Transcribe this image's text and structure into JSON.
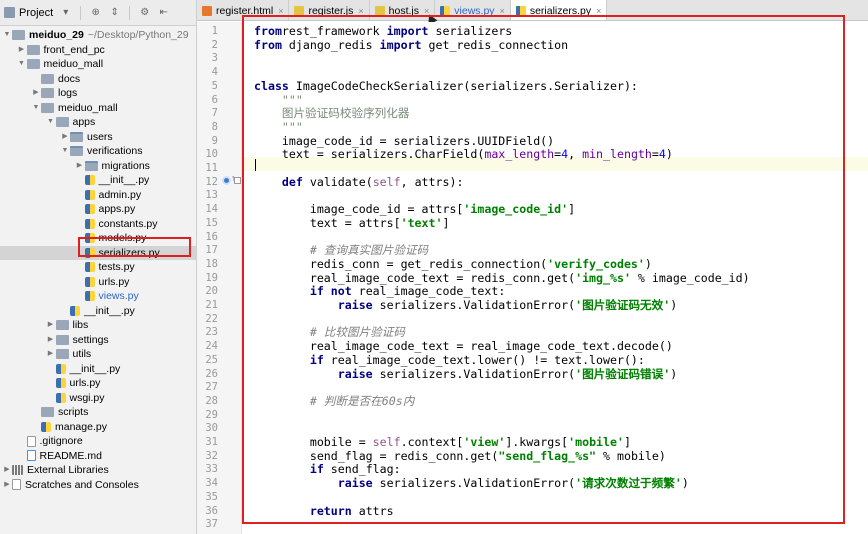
{
  "project_panel": {
    "title": "Project",
    "toolbar_icons": [
      "project-folder-icon",
      "target-icon",
      "collapse-icon",
      "gear-icon",
      "hide-icon"
    ],
    "tree": [
      {
        "depth": 0,
        "arrow": "down",
        "icon": "folder",
        "label": "meiduo_29",
        "extra": "~/Desktop/Python_29",
        "bold": true
      },
      {
        "depth": 1,
        "arrow": "right",
        "icon": "folder",
        "label": "front_end_pc"
      },
      {
        "depth": 1,
        "arrow": "down",
        "icon": "folder",
        "label": "meiduo_mall"
      },
      {
        "depth": 2,
        "arrow": "",
        "icon": "folder",
        "label": "docs"
      },
      {
        "depth": 2,
        "arrow": "right",
        "icon": "folder",
        "label": "logs"
      },
      {
        "depth": 2,
        "arrow": "down",
        "icon": "folder",
        "label": "meiduo_mall"
      },
      {
        "depth": 3,
        "arrow": "down",
        "icon": "folder",
        "label": "apps"
      },
      {
        "depth": 4,
        "arrow": "right",
        "icon": "pkg",
        "label": "users"
      },
      {
        "depth": 4,
        "arrow": "down",
        "icon": "pkg",
        "label": "verifications"
      },
      {
        "depth": 5,
        "arrow": "right",
        "icon": "pkg",
        "label": "migrations"
      },
      {
        "depth": 5,
        "arrow": "",
        "icon": "py",
        "label": "__init__.py"
      },
      {
        "depth": 5,
        "arrow": "",
        "icon": "py",
        "label": "admin.py"
      },
      {
        "depth": 5,
        "arrow": "",
        "icon": "py",
        "label": "apps.py"
      },
      {
        "depth": 5,
        "arrow": "",
        "icon": "py",
        "label": "constants.py"
      },
      {
        "depth": 5,
        "arrow": "",
        "icon": "py",
        "label": "models.py"
      },
      {
        "depth": 5,
        "arrow": "",
        "icon": "py",
        "label": "serializers.py",
        "selected": true
      },
      {
        "depth": 5,
        "arrow": "",
        "icon": "py",
        "label": "tests.py"
      },
      {
        "depth": 5,
        "arrow": "",
        "icon": "py",
        "label": "urls.py"
      },
      {
        "depth": 5,
        "arrow": "",
        "icon": "py",
        "label": "views.py",
        "modified": true
      },
      {
        "depth": 4,
        "arrow": "",
        "icon": "py",
        "label": "__init__.py"
      },
      {
        "depth": 3,
        "arrow": "right",
        "icon": "folder",
        "label": "libs"
      },
      {
        "depth": 3,
        "arrow": "right",
        "icon": "folder",
        "label": "settings"
      },
      {
        "depth": 3,
        "arrow": "right",
        "icon": "folder",
        "label": "utils"
      },
      {
        "depth": 3,
        "arrow": "",
        "icon": "py",
        "label": "__init__.py"
      },
      {
        "depth": 3,
        "arrow": "",
        "icon": "py",
        "label": "urls.py"
      },
      {
        "depth": 3,
        "arrow": "",
        "icon": "py",
        "label": "wsgi.py"
      },
      {
        "depth": 2,
        "arrow": "",
        "icon": "folder",
        "label": "scripts"
      },
      {
        "depth": 2,
        "arrow": "",
        "icon": "py",
        "label": "manage.py"
      },
      {
        "depth": 1,
        "arrow": "",
        "icon": "txt",
        "label": ".gitignore"
      },
      {
        "depth": 1,
        "arrow": "",
        "icon": "md",
        "label": "README.md"
      },
      {
        "depth": 0,
        "arrow": "right",
        "icon": "lib",
        "label": "External Libraries"
      },
      {
        "depth": 0,
        "arrow": "right",
        "icon": "txt",
        "label": "Scratches and Consoles"
      }
    ]
  },
  "tabs": [
    {
      "label": "register.html",
      "icon": "html",
      "active": false,
      "modified": false
    },
    {
      "label": "register.js",
      "icon": "js",
      "active": false,
      "modified": false
    },
    {
      "label": "host.js",
      "icon": "js",
      "active": false,
      "modified": false
    },
    {
      "label": "views.py",
      "icon": "py",
      "active": false,
      "modified": true
    },
    {
      "label": "serializers.py",
      "icon": "py",
      "active": true,
      "modified": false
    }
  ],
  "tab_close_glyph": "×",
  "editor": {
    "lines": [
      {
        "n": "1",
        "t": [
          [
            "kw",
            "from"
          ],
          [
            "",
            "rest_framework "
          ],
          [
            "kw",
            "import"
          ],
          [
            "",
            " serializers"
          ]
        ]
      },
      {
        "n": "2",
        "t": [
          [
            "kw",
            "from"
          ],
          [
            "",
            " django_redis "
          ],
          [
            "kw",
            "import"
          ],
          [
            "",
            " get_redis_connection"
          ]
        ]
      },
      {
        "n": "3",
        "t": []
      },
      {
        "n": "4",
        "t": []
      },
      {
        "n": "5",
        "t": [
          [
            "kw",
            "class"
          ],
          [
            "",
            " ImageCodeCheckSerializer(serializers.Serializer):"
          ]
        ]
      },
      {
        "n": "6",
        "t": [
          [
            "doc",
            "    \"\"\""
          ]
        ]
      },
      {
        "n": "7",
        "t": [
          [
            "doc",
            "    图片验证码校验序列化器"
          ]
        ]
      },
      {
        "n": "8",
        "t": [
          [
            "doc",
            "    \"\"\""
          ]
        ]
      },
      {
        "n": "9",
        "t": [
          [
            "",
            "    image_code_id = serializers.UUIDField()"
          ]
        ]
      },
      {
        "n": "10",
        "t": [
          [
            "",
            "    text = serializers.CharField("
          ],
          [
            "par",
            "max_length"
          ],
          [
            "",
            "="
          ],
          [
            "num",
            "4"
          ],
          [
            ", ",
            ", "
          ],
          [
            "par",
            "min_length"
          ],
          [
            "",
            "="
          ],
          [
            "num",
            "4"
          ],
          [
            "",
            ")"
          ]
        ]
      },
      {
        "n": "11",
        "t": []
      },
      {
        "n": "12",
        "t": [
          [
            "",
            "    "
          ],
          [
            "kw",
            "def"
          ],
          [
            "",
            " validate("
          ],
          [
            "self",
            "self"
          ],
          [
            "",
            ", attrs):"
          ]
        ]
      },
      {
        "n": "13",
        "t": []
      },
      {
        "n": "14",
        "t": [
          [
            "",
            "        image_code_id = attrs["
          ],
          [
            "str",
            "'image_code_id'"
          ],
          [
            "",
            "]"
          ]
        ]
      },
      {
        "n": "15",
        "t": [
          [
            "",
            "        text = attrs["
          ],
          [
            "str",
            "'text'"
          ],
          [
            "",
            "]"
          ]
        ]
      },
      {
        "n": "16",
        "t": []
      },
      {
        "n": "17",
        "t": [
          [
            "cmt",
            "        # 查询真实图片验证码"
          ]
        ]
      },
      {
        "n": "18",
        "t": [
          [
            "",
            "        redis_conn = get_redis_connection("
          ],
          [
            "str",
            "'verify_codes'"
          ],
          [
            "",
            ")"
          ]
        ]
      },
      {
        "n": "19",
        "t": [
          [
            "",
            "        real_image_code_text = redis_conn.get("
          ],
          [
            "str",
            "'img_%s'"
          ],
          [
            "",
            " % image_code_id)"
          ]
        ]
      },
      {
        "n": "20",
        "t": [
          [
            "",
            "        "
          ],
          [
            "kw",
            "if not"
          ],
          [
            "",
            " real_image_code_text:"
          ]
        ]
      },
      {
        "n": "21",
        "t": [
          [
            "",
            "            "
          ],
          [
            "kw",
            "raise"
          ],
          [
            "",
            " serializers.ValidationError("
          ],
          [
            "str",
            "'图片验证码无效'"
          ],
          [
            "",
            ")"
          ]
        ]
      },
      {
        "n": "22",
        "t": []
      },
      {
        "n": "23",
        "t": [
          [
            "cmt",
            "        # 比较图片验证码"
          ]
        ]
      },
      {
        "n": "24",
        "t": [
          [
            "",
            "        real_image_code_text = real_image_code_text.decode()"
          ]
        ]
      },
      {
        "n": "25",
        "t": [
          [
            "",
            "        "
          ],
          [
            "kw",
            "if"
          ],
          [
            "",
            " real_image_code_text.lower() != text.lower():"
          ]
        ]
      },
      {
        "n": "26",
        "t": [
          [
            "",
            "            "
          ],
          [
            "kw",
            "raise"
          ],
          [
            "",
            " serializers.ValidationError("
          ],
          [
            "str",
            "'图片验证码错误'"
          ],
          [
            "",
            ")"
          ]
        ]
      },
      {
        "n": "27",
        "t": []
      },
      {
        "n": "28",
        "t": [
          [
            "cmt",
            "        # 判断是否在60s内"
          ]
        ]
      },
      {
        "n": "29",
        "t": []
      },
      {
        "n": "30",
        "t": []
      },
      {
        "n": "31",
        "t": [
          [
            "",
            "        mobile = "
          ],
          [
            "self",
            "self"
          ],
          [
            "",
            ".context["
          ],
          [
            "str",
            "'view'"
          ],
          [
            "",
            "].kwargs["
          ],
          [
            "str",
            "'mobile'"
          ],
          [
            "",
            "]"
          ]
        ]
      },
      {
        "n": "32",
        "t": [
          [
            "",
            "        send_flag = redis_conn.get("
          ],
          [
            "str",
            "\"send_flag_%s\""
          ],
          [
            "",
            " % mobile)"
          ]
        ]
      },
      {
        "n": "33",
        "t": [
          [
            "",
            "        "
          ],
          [
            "kw",
            "if"
          ],
          [
            "",
            " send_flag:"
          ]
        ]
      },
      {
        "n": "34",
        "t": [
          [
            "",
            "            "
          ],
          [
            "kw",
            "raise"
          ],
          [
            "",
            " serializers.ValidationError("
          ],
          [
            "str",
            "'请求次数过于频繁'"
          ],
          [
            "",
            ")"
          ]
        ]
      },
      {
        "n": "35",
        "t": []
      },
      {
        "n": "36",
        "t": [
          [
            "",
            "        "
          ],
          [
            "kw",
            "return"
          ],
          [
            "",
            " attrs"
          ]
        ]
      },
      {
        "n": "37",
        "t": []
      }
    ]
  }
}
